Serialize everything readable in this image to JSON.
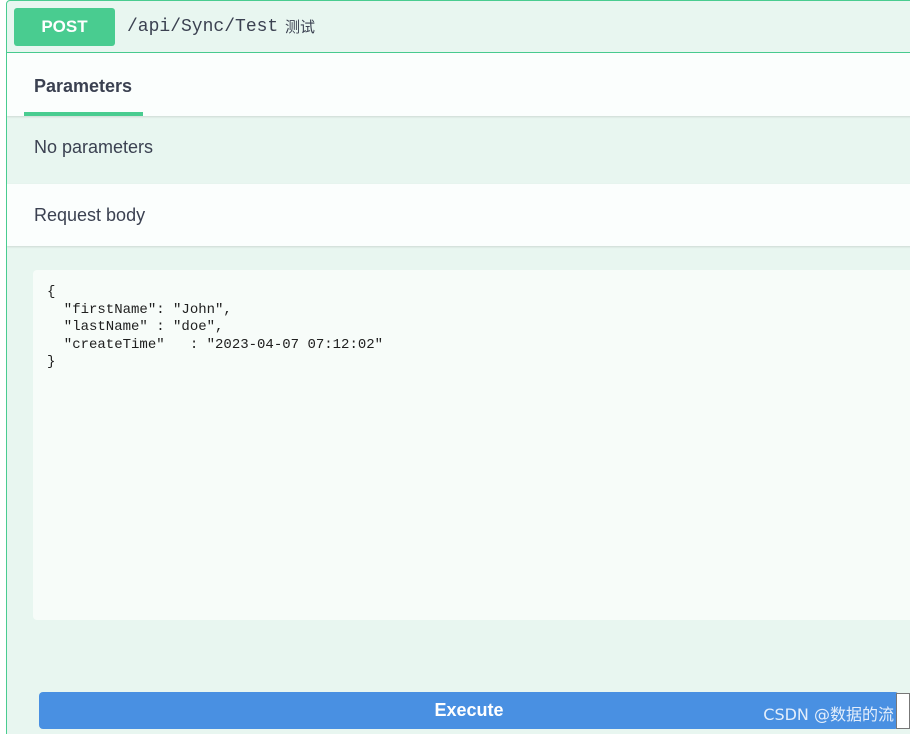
{
  "operation": {
    "method": "POST",
    "path": "/api/Sync/Test",
    "description": "测试"
  },
  "tabs": {
    "parameters_label": "Parameters"
  },
  "parameters": {
    "empty_text": "No parameters"
  },
  "request_body": {
    "label": "Request body",
    "value": "{\n  \"firstName\": \"John\",\n  \"lastName\" : \"doe\",\n  \"createTime\"   : \"2023-04-07 07:12:02\"\n}"
  },
  "actions": {
    "execute_label": "Execute"
  },
  "watermark": "CSDN @数据的流",
  "colors": {
    "post_green": "#49cc90",
    "block_background": "#e8f6f0",
    "execute_blue": "#4990e2",
    "text_dark": "#3b4151"
  }
}
